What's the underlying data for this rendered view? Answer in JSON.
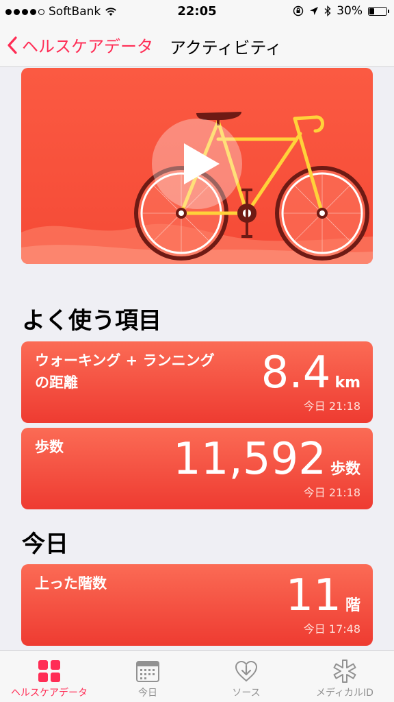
{
  "status_bar": {
    "carrier": "SoftBank",
    "time": "22:05",
    "battery": "30%",
    "battery_level": 0.3
  },
  "nav": {
    "back_label": "ヘルスケアデータ",
    "title": "アクティビティ"
  },
  "sections": {
    "favorites_title": "よく使う項目",
    "today_title": "今日"
  },
  "cards": {
    "walking": {
      "label_line1": "ウォーキング + ランニング",
      "label_line2": "の距離",
      "value": "8.4",
      "unit": "km",
      "time": "今日 21:18"
    },
    "steps": {
      "label": "歩数",
      "value": "11,592",
      "unit": "歩数",
      "time": "今日 21:18"
    },
    "floors": {
      "label": "上った階数",
      "value": "11",
      "unit": "階",
      "time": "今日 17:48"
    }
  },
  "tab_bar": {
    "items": [
      {
        "label": "ヘルスケアデータ",
        "icon": "grid-icon",
        "active": true
      },
      {
        "label": "今日",
        "icon": "calendar-icon",
        "active": false
      },
      {
        "label": "ソース",
        "icon": "heart-download-icon",
        "active": false
      },
      {
        "label": "メディカルID",
        "icon": "asterisk-icon",
        "active": false
      }
    ]
  },
  "colors": {
    "accent": "#ff2d55",
    "card": "#f54a36"
  }
}
